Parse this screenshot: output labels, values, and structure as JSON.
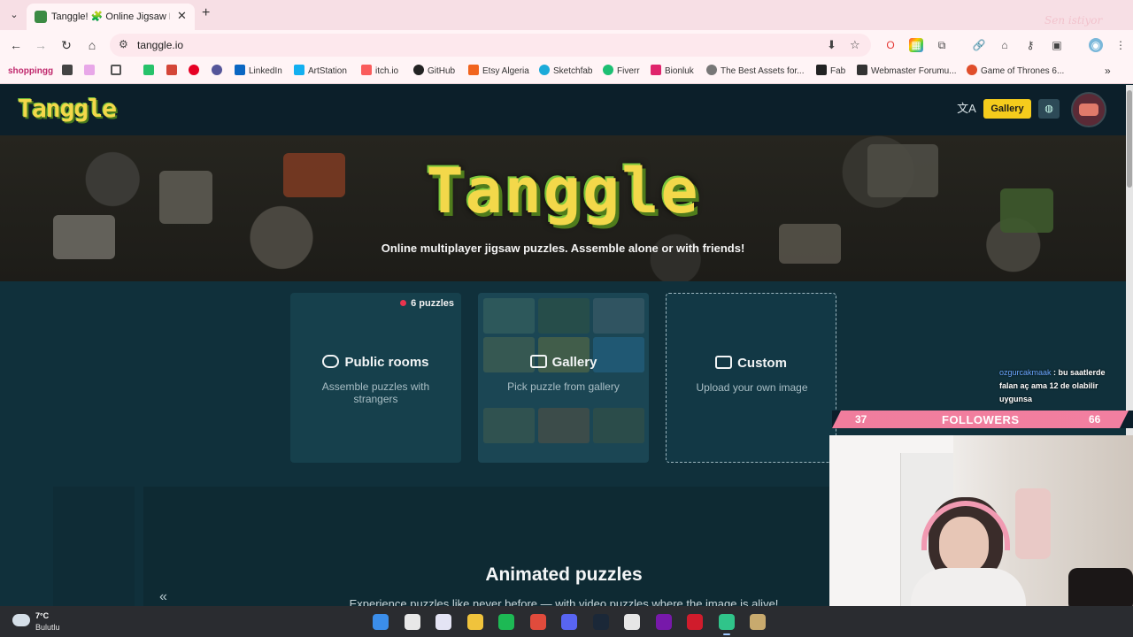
{
  "browser": {
    "tab_title": "Tanggle! 🧩 Online Jigsaw Puzz",
    "tab_close": "✕",
    "new_tab": "+",
    "tab_menu": "⌄",
    "url": "tanggle.io",
    "watermark": "Sen istiyor",
    "nav": {
      "back": "←",
      "forward": "→",
      "reload": "↻",
      "home": "⌂"
    },
    "omni_icons": {
      "site_info": "⚙",
      "install": "⬇",
      "bookmark": "☆"
    },
    "extensions": [
      "O",
      "▦",
      "⧉",
      "🔗",
      "⌂",
      "⚷",
      "▣",
      "◉",
      "⋮"
    ],
    "bookmarks": [
      {
        "label": "shoppingg",
        "icon": "none",
        "color": "#c0296d"
      },
      {
        "label": "",
        "icon": "square",
        "color": "#444444"
      },
      {
        "label": "",
        "icon": "pen",
        "color": "#c06ac0"
      },
      {
        "label": "",
        "icon": "grid",
        "color": "#555555"
      },
      {
        "label": "",
        "icon": "kickstarter",
        "color": "#27c26a"
      },
      {
        "label": "",
        "icon": "gmail",
        "color": "#d44638"
      },
      {
        "label": "",
        "icon": "pinterest",
        "color": "#e60023"
      },
      {
        "label": "",
        "icon": "target",
        "color": "#555599"
      },
      {
        "label": "LinkedIn",
        "icon": "linkedin",
        "color": "#0a66c2"
      },
      {
        "label": "ArtStation",
        "icon": "artstation",
        "color": "#13aff0"
      },
      {
        "label": "itch.io",
        "icon": "itch",
        "color": "#fa5c5c"
      },
      {
        "label": "GitHub",
        "icon": "github",
        "color": "#222222"
      },
      {
        "label": "Etsy Algeria",
        "icon": "etsy",
        "color": "#f1641e"
      },
      {
        "label": "Sketchfab",
        "icon": "sketchfab",
        "color": "#1caad9"
      },
      {
        "label": "Fiverr",
        "icon": "fiverr",
        "color": "#1dbf73"
      },
      {
        "label": "Bionluk",
        "icon": "bionluk",
        "color": "#e0246c"
      },
      {
        "label": "The Best Assets for...",
        "icon": "unity",
        "color": "#555555"
      },
      {
        "label": "Fab",
        "icon": "fab",
        "color": "#222222"
      },
      {
        "label": "Webmaster Forumu...",
        "icon": "webmaster",
        "color": "#333333"
      },
      {
        "label": "Game of Thrones 6...",
        "icon": "got",
        "color": "#e04e2b"
      }
    ],
    "bookmarks_more": "»"
  },
  "site": {
    "logo": "Tanggle",
    "header_buttons": {
      "translate": "文A",
      "gallery": "Gallery",
      "discord": "◍"
    },
    "hero_title": "Tanggle",
    "hero_subtitle": "Online multiplayer jigsaw puzzles. Assemble alone or with friends!",
    "cards": [
      {
        "title": "Public rooms",
        "subtitle": "Assemble puzzles with strangers",
        "badge": "6 puzzles",
        "icon": "users-icon"
      },
      {
        "title": "Gallery",
        "subtitle": "Pick puzzle from gallery",
        "icon": "image-icon"
      },
      {
        "title": "Custom",
        "subtitle": "Upload your own image",
        "icon": "image-plus-icon"
      }
    ],
    "collapse": "«",
    "animated_title": "Animated puzzles",
    "animated_subtitle": "Experience puzzles like never before — with video puzzles where the image is alive!"
  },
  "stream": {
    "chat_user": "ozgurcakmaak",
    "chat_message": " : bu saatlerde falan aç ama 12 de olabilir uygunsa",
    "followers_current": "37",
    "followers_label": "FOLLOWERS",
    "followers_goal": "66"
  },
  "taskbar": {
    "temp": "7°C",
    "weather": "Bulutlu",
    "apps": [
      {
        "name": "windows",
        "color": "#3b8eea"
      },
      {
        "name": "yandex",
        "color": "#e8e8e8"
      },
      {
        "name": "snipping",
        "color": "#e4e4f4"
      },
      {
        "name": "explorer",
        "color": "#f0c33c"
      },
      {
        "name": "spotify",
        "color": "#1db954"
      },
      {
        "name": "chrome",
        "color": "#e04b3c"
      },
      {
        "name": "discord",
        "color": "#5865f2"
      },
      {
        "name": "steam",
        "color": "#1b2838"
      },
      {
        "name": "obs",
        "color": "#e6e6e6"
      },
      {
        "name": "onenote",
        "color": "#7719aa"
      },
      {
        "name": "app-red",
        "color": "#d01c2c"
      },
      {
        "name": "app-green",
        "color": "#30c48a"
      },
      {
        "name": "league",
        "color": "#c8aa6e"
      }
    ]
  }
}
